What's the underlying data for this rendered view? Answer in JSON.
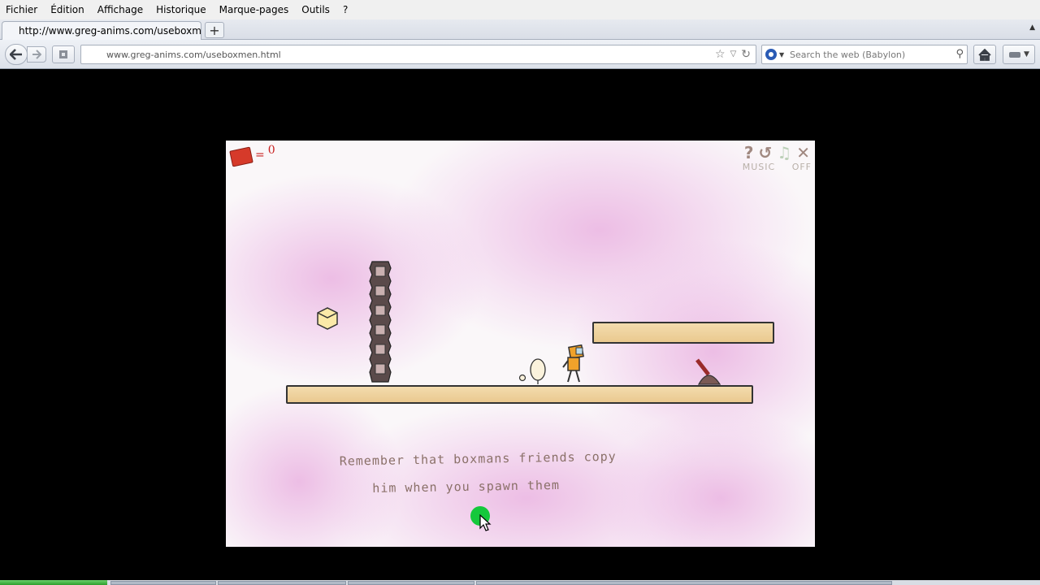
{
  "menu": [
    "Fichier",
    "Édition",
    "Affichage",
    "Historique",
    "Marque-pages",
    "Outils",
    "?"
  ],
  "tab": {
    "title": "http://www.greg-anims.com/useboxmen.html",
    "new_tab": "+"
  },
  "nav": {
    "url": "www.greg-anims.com/useboxmen.html",
    "search_placeholder": "Search the web (Babylon)"
  },
  "game": {
    "box_count": "0",
    "hud_eq": "=",
    "music_label": "MUSIC",
    "music_state": "OFF",
    "hint_line1": "Remember that boxmans friends copy",
    "hint_line2": "him when you spawn them"
  },
  "colors": {
    "background": "#000000",
    "chrome": "#f0f0f0",
    "platform": "#eac98f",
    "counter_red": "#c82020",
    "cursor_dot": "#15c83c"
  },
  "icons": [
    "back-arrow-icon",
    "forward-arrow-icon",
    "identity-icon",
    "star-icon",
    "dropdown-icon",
    "reload-icon",
    "babylon-icon",
    "search-icon",
    "home-icon",
    "addon-icon",
    "help-icon",
    "restart-icon",
    "music-icon",
    "close-icon"
  ]
}
